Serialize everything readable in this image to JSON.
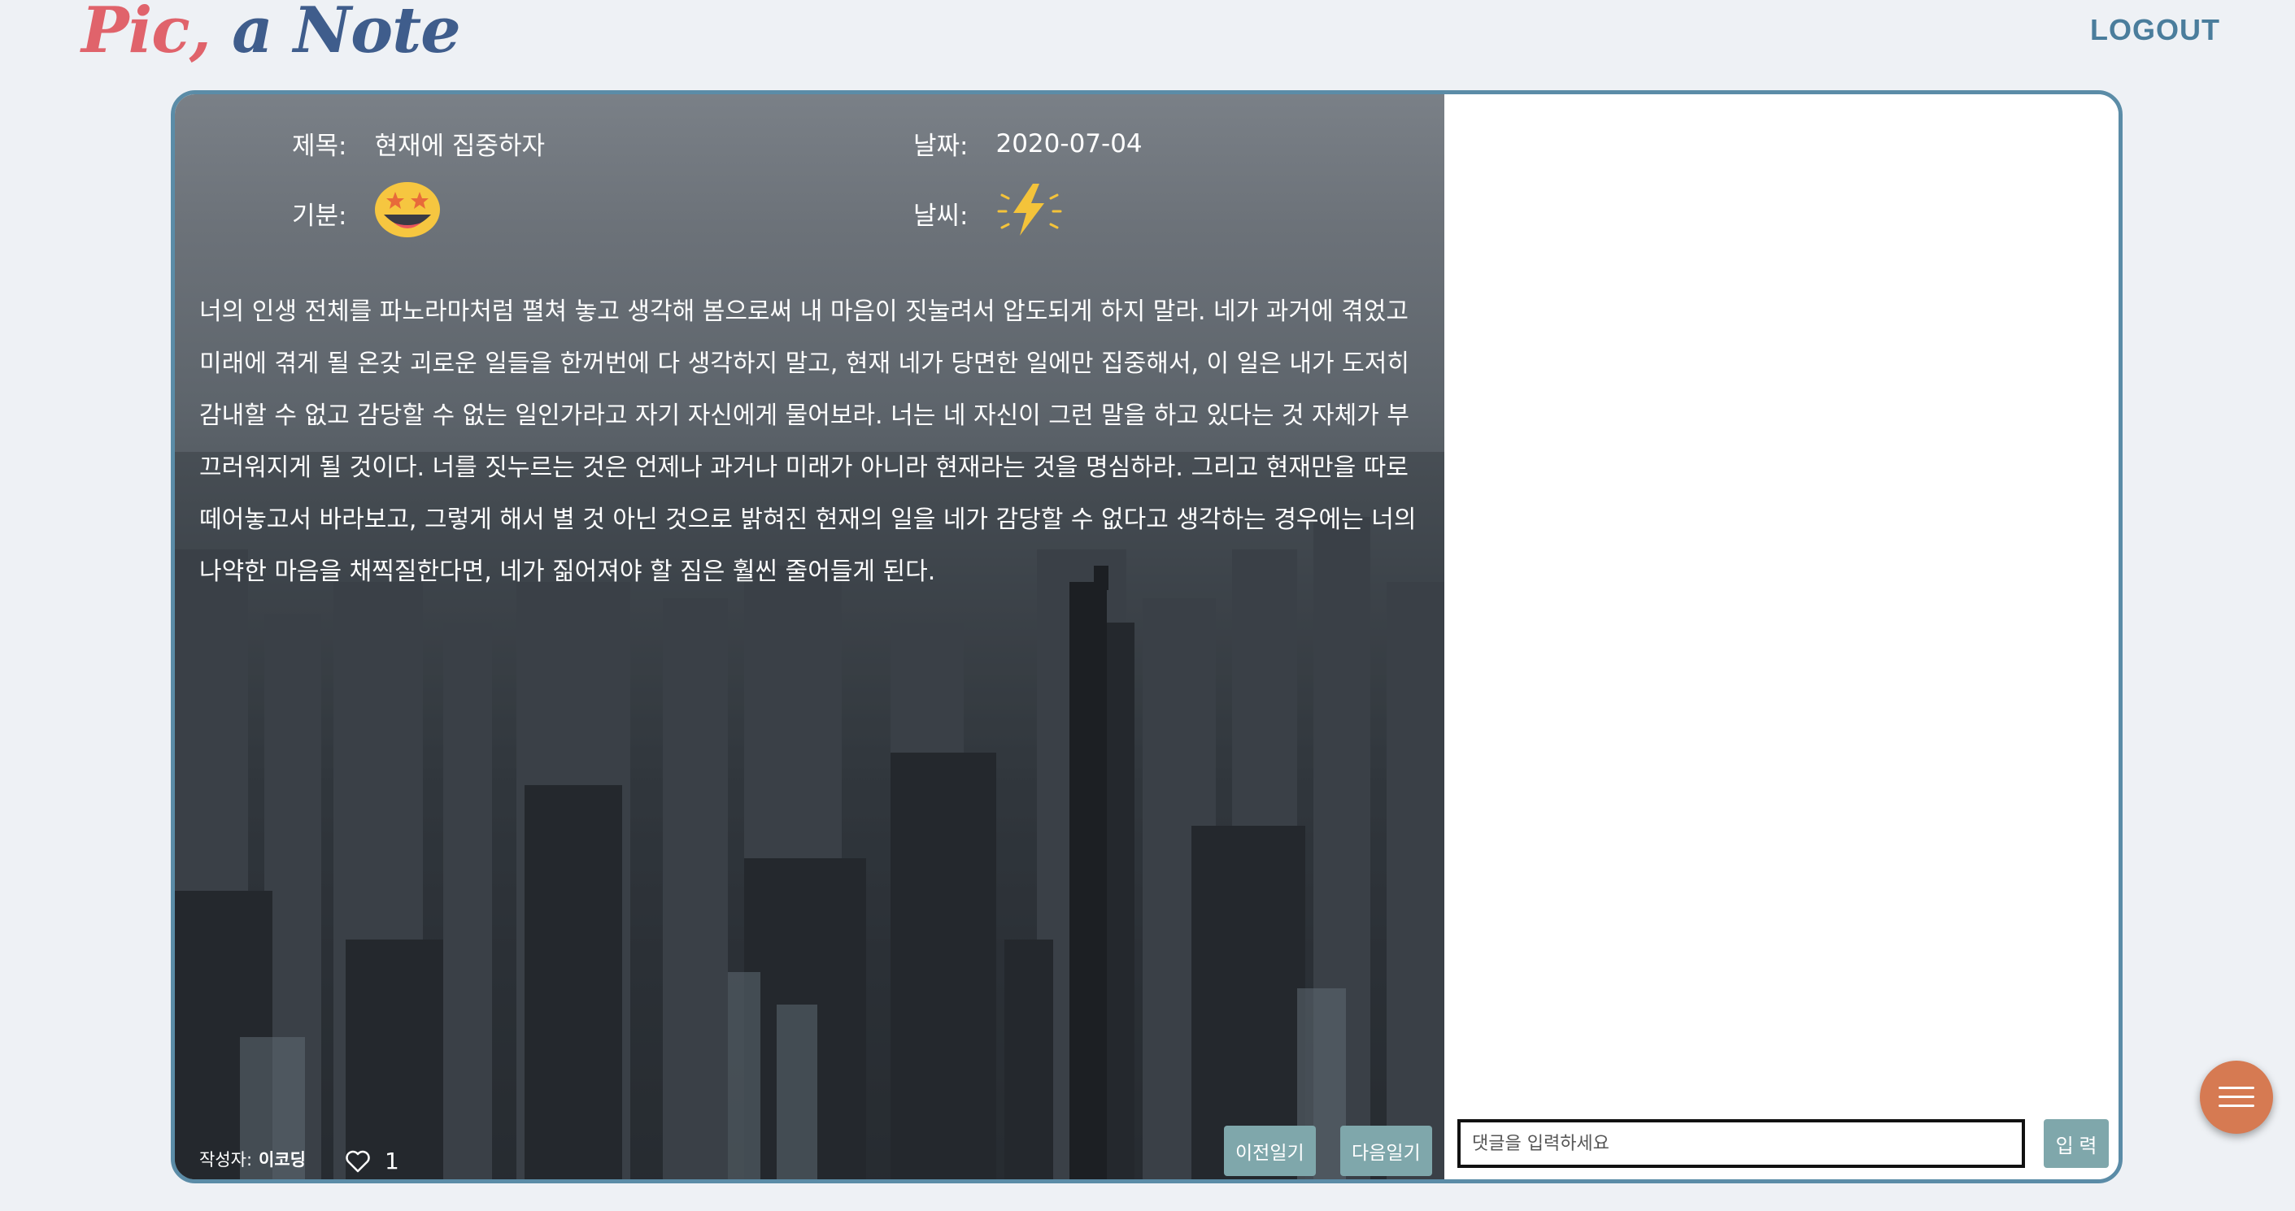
{
  "header": {
    "logo_part1": "Pic,",
    "logo_part2": " a Note",
    "logout_label": "LOGOUT"
  },
  "diary": {
    "title_label": "제목:",
    "title_value": "현재에 집중하자",
    "date_label": "날짜:",
    "date_value": "2020-07-04",
    "mood_label": "기분:",
    "mood_icon": "star-eyes-emoji-icon",
    "weather_label": "날씨:",
    "weather_icon": "lightning-icon",
    "content": "너의 인생 전체를 파노라마처럼 펼쳐 놓고 생각해 봄으로써 내 마음이 짓눌려서 압도되게 하지 말라. 네가 과거에 겪었고 미래에 겪게 될 온갖 괴로운 일들을 한꺼번에 다 생각하지 말고, 현재 네가 당면한 일에만 집중해서, 이 일은 내가 도저히 감내할 수 없고 감당할 수 없는 일인가라고 자기 자신에게 물어보라. 너는 네 자신이 그런 말을 하고 있다는 것 자체가 부끄러워지게 될 것이다. 너를 짓누르는 것은 언제나 과거나 미래가 아니라 현재라는 것을 명심하라. 그리고 현재만을 따로 떼어놓고서 바라보고, 그렇게 해서 별 것 아닌 것으로 밝혀진 현재의 일을 네가 감당할 수 없다고 생각하는 경우에는 너의 나약한 마음을 채찍질한다면, 네가 짊어져야 할 짐은 훨씬 줄어들게 된다.",
    "author_label": "작성자:",
    "author_name": "이코딩",
    "like_count": "1",
    "prev_label": "이전일기",
    "next_label": "다음일기"
  },
  "comments": {
    "input_placeholder": "댓글을 입력하세요",
    "submit_label": "입 력"
  },
  "colors": {
    "accent": "#5b8ca7",
    "button": "#7fa7ab",
    "fab": "#d67a52",
    "logo_red": "#e0636b",
    "logo_blue": "#3f5d8c"
  },
  "fab_icon": "hamburger-menu-icon"
}
